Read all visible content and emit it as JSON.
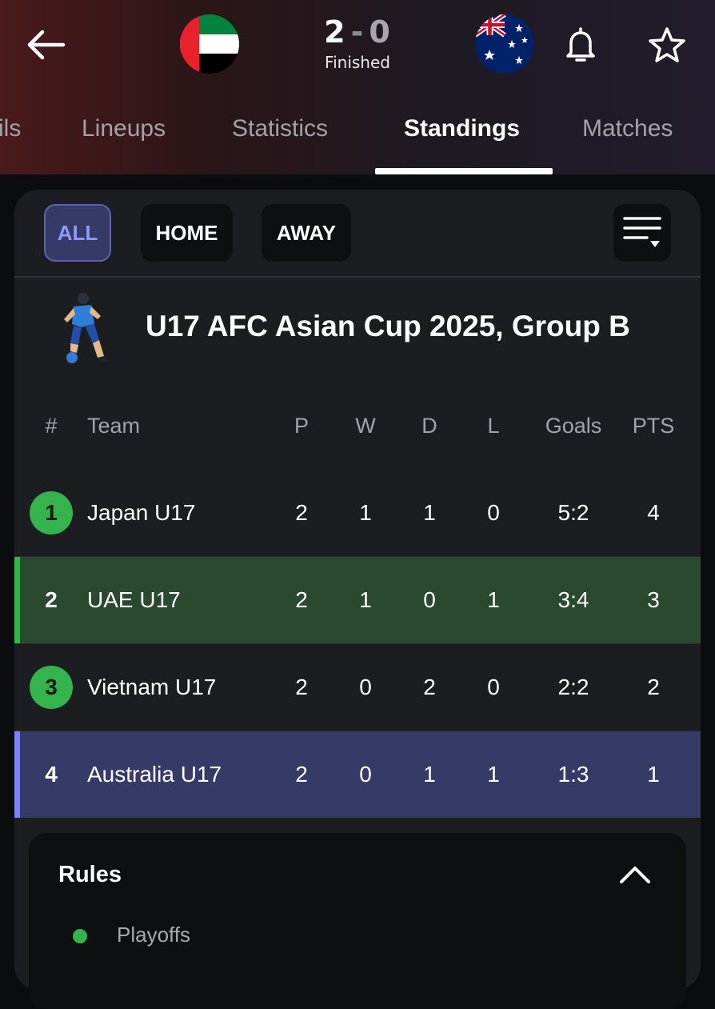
{
  "header": {
    "home_team_flag": "uae-flag-icon",
    "away_team_flag": "australia-flag-icon",
    "score_home": "2",
    "score_separator": "-",
    "score_away": "0",
    "status": "Finished"
  },
  "tabs": [
    {
      "label": "ils"
    },
    {
      "label": "Lineups"
    },
    {
      "label": "Statistics"
    },
    {
      "label": "Standings",
      "active": true
    },
    {
      "label": "Matches"
    }
  ],
  "filters": {
    "all": "ALL",
    "home": "HOME",
    "away": "AWAY"
  },
  "competition": {
    "title": "U17 AFC Asian Cup 2025, Group B"
  },
  "table": {
    "headers": {
      "pos": "#",
      "team": "Team",
      "p": "P",
      "w": "W",
      "d": "D",
      "l": "L",
      "goals": "Goals",
      "pts": "PTS"
    },
    "rows": [
      {
        "pos": "1",
        "team": "Japan U17",
        "p": "2",
        "w": "1",
        "d": "1",
        "l": "0",
        "goals": "5:2",
        "pts": "4"
      },
      {
        "pos": "2",
        "team": "UAE U17",
        "p": "2",
        "w": "1",
        "d": "0",
        "l": "1",
        "goals": "3:4",
        "pts": "3"
      },
      {
        "pos": "3",
        "team": "Vietnam U17",
        "p": "2",
        "w": "0",
        "d": "2",
        "l": "0",
        "goals": "2:2",
        "pts": "2"
      },
      {
        "pos": "4",
        "team": "Australia U17",
        "p": "2",
        "w": "0",
        "d": "1",
        "l": "1",
        "goals": "1:3",
        "pts": "1"
      }
    ]
  },
  "rules": {
    "title": "Rules",
    "legend": [
      {
        "label": "Playoffs",
        "color": "#35b44e"
      }
    ]
  },
  "colors": {
    "accent": "#8f99ff",
    "playoff_green": "#35b44e",
    "highlight_home": "#2a4a2f",
    "highlight_away": "#363a66"
  }
}
